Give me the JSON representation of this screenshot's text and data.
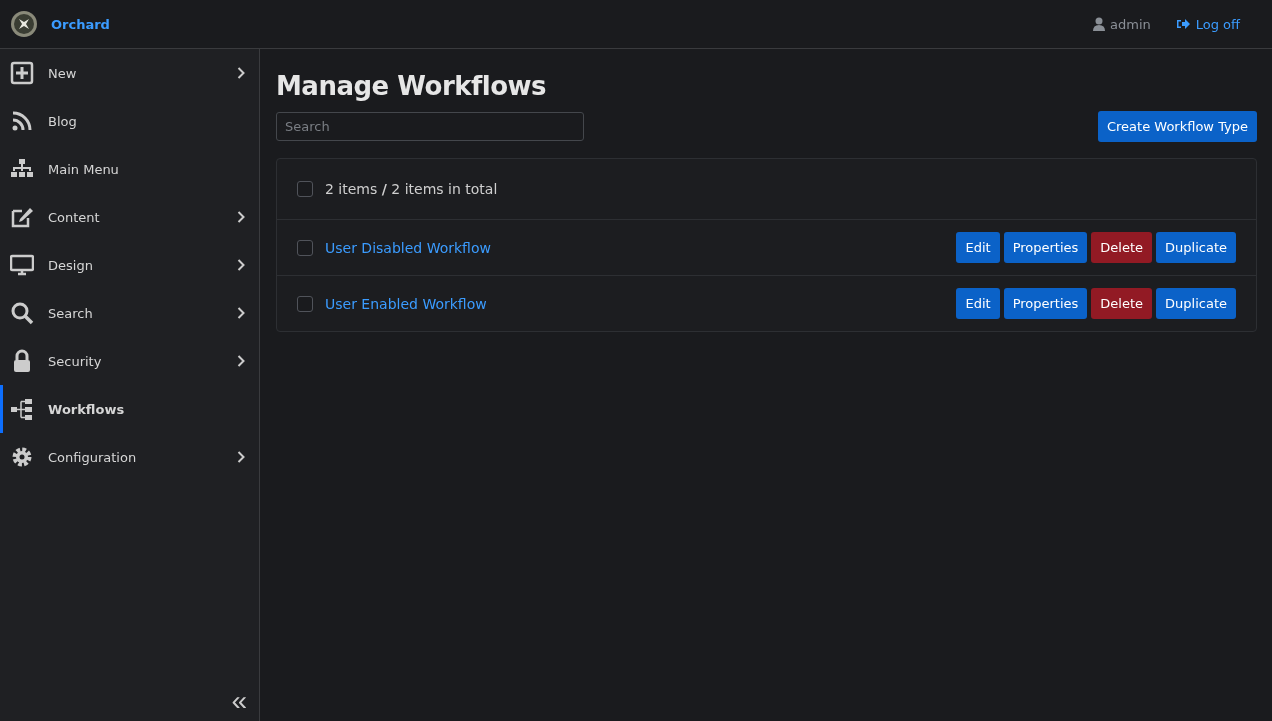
{
  "brand": {
    "name": "Orchard"
  },
  "user": {
    "name": "admin",
    "logoff": "Log off"
  },
  "sidebar": {
    "items": [
      {
        "label": "New",
        "expandable": true,
        "selected": false
      },
      {
        "label": "Blog",
        "expandable": false,
        "selected": false
      },
      {
        "label": "Main Menu",
        "expandable": false,
        "selected": false
      },
      {
        "label": "Content",
        "expandable": true,
        "selected": false
      },
      {
        "label": "Design",
        "expandable": true,
        "selected": false
      },
      {
        "label": "Search",
        "expandable": true,
        "selected": false
      },
      {
        "label": "Security",
        "expandable": true,
        "selected": false
      },
      {
        "label": "Workflows",
        "expandable": false,
        "selected": true
      },
      {
        "label": "Configuration",
        "expandable": true,
        "selected": false
      }
    ],
    "collapse": "«"
  },
  "page": {
    "title": "Manage Workflows",
    "search": {
      "placeholder": "Search"
    },
    "create_button": "Create Workflow Type"
  },
  "list": {
    "summary": "2 items **/** 2 items in total",
    "select_all_checked": false,
    "rows": [
      {
        "name": "User Disabled Workflow",
        "checked": false,
        "buttons": [
          {
            "label": "Edit",
            "kind": "primary"
          },
          {
            "label": "Properties",
            "kind": "primary"
          },
          {
            "label": "Delete",
            "kind": "danger"
          },
          {
            "label": "Duplicate",
            "kind": "primary"
          }
        ]
      },
      {
        "name": "User Enabled Workflow",
        "checked": false,
        "buttons": [
          {
            "label": "Edit",
            "kind": "primary"
          },
          {
            "label": "Properties",
            "kind": "primary"
          },
          {
            "label": "Delete",
            "kind": "danger"
          },
          {
            "label": "Duplicate",
            "kind": "primary"
          }
        ]
      }
    ]
  }
}
